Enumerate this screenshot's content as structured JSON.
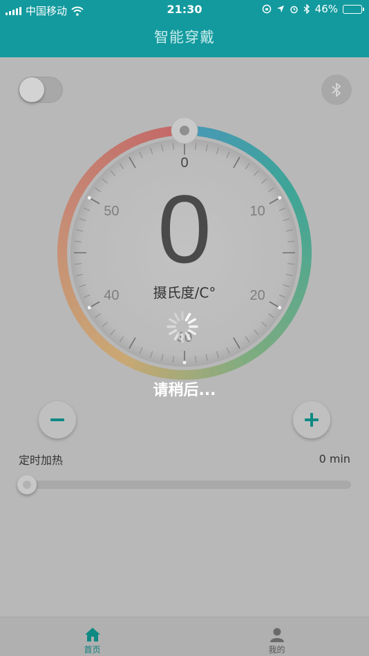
{
  "status_bar": {
    "carrier": "中国移动",
    "time": "21:30",
    "battery": "46%",
    "battery_level": 0.46
  },
  "nav": {
    "title": "智能穿戴"
  },
  "controls": {
    "power_toggle_on": false
  },
  "dial": {
    "value": "0",
    "unit": "摄氏度/C°",
    "scale_labels": [
      {
        "text": "0",
        "value": 0
      },
      {
        "text": "10",
        "value": 10
      },
      {
        "text": "20",
        "value": 20
      },
      {
        "text": "30",
        "value": 30
      },
      {
        "text": "40",
        "value": 40
      },
      {
        "text": "50",
        "value": 50
      }
    ],
    "scale_max": 60,
    "colors": {
      "cool": "#1e8cb8",
      "teal": "#0f9e8a",
      "green": "#6aa86a",
      "warm": "#d2a25a",
      "orange": "#cc7e5c",
      "red": "#c94848"
    }
  },
  "loading": {
    "text": "请稍后..."
  },
  "timer": {
    "label": "定时加热",
    "value": "0 min",
    "level": 0
  },
  "tabs": [
    {
      "label": "首页",
      "active": true
    },
    {
      "label": "我的",
      "active": false
    }
  ],
  "icons": {
    "bluetooth": "bluetooth-icon",
    "minus": "minus-icon",
    "plus": "plus-icon",
    "home": "home-icon",
    "user": "user-icon",
    "spinner": "loading-spinner-icon"
  },
  "accent_color": "#139a9e"
}
